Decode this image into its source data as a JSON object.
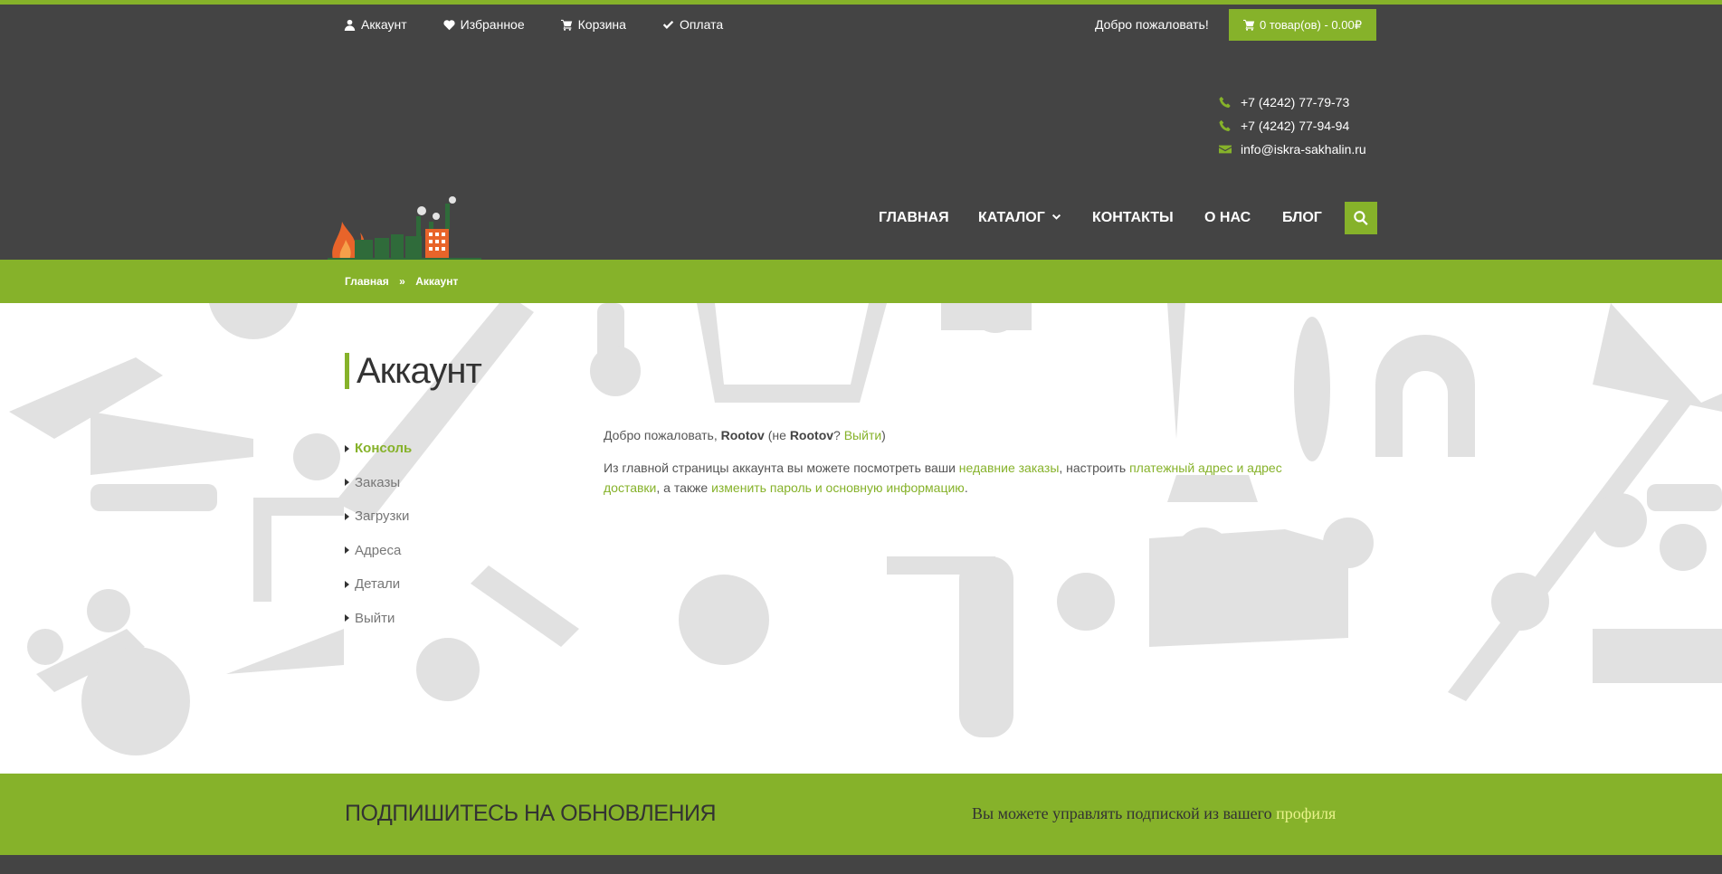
{
  "topbar": {
    "links": [
      {
        "label": "Аккаунт",
        "icon": "user-icon"
      },
      {
        "label": "Избранное",
        "icon": "heart-icon"
      },
      {
        "label": "Корзина",
        "icon": "cart-icon"
      },
      {
        "label": "Оплата",
        "icon": "check-icon"
      }
    ],
    "welcome": "Добро пожаловать!",
    "cart": "0 товар(ов) - 0.00₽"
  },
  "contacts": {
    "phone1": "+7 (4242) 77-79-73",
    "phone2": "+7 (4242) 77-94-94",
    "email": "info@iskra-sakhalin.ru"
  },
  "nav": {
    "home": "ГЛАВНАЯ",
    "catalog": "КАТАЛОГ",
    "contacts": "КОНТАКТЫ",
    "about": "О НАС",
    "blog": "БЛОГ"
  },
  "breadcrumb": {
    "home": "Главная",
    "sep": "»",
    "current": "Аккаунт"
  },
  "page": {
    "title": "Аккаунт",
    "menu": [
      "Консоль",
      "Заказы",
      "Загрузки",
      "Адреса",
      "Детали",
      "Выйти"
    ]
  },
  "account": {
    "p1_a": "Добро пожаловать, ",
    "user": "Rootov",
    "p1_b": " (не ",
    "user2": "Rootov",
    "p1_c": "? ",
    "logout": "Выйти",
    "p1_d": ")",
    "p2_a": "Из главной страницы аккаунта вы можете посмотреть ваши ",
    "recent_orders": "недавние заказы",
    "p2_b": ", настроить ",
    "addresses": "платежный адрес и адрес доставки",
    "p2_c": ", а также ",
    "edit": "изменить пароль и основную информацию",
    "p2_d": "."
  },
  "subscribe": {
    "title": "ПОДПИШИТЕСЬ НА ОБНОВЛЕНИЯ",
    "note": "Вы можете управлять подпиской из вашего ",
    "link": "профиля"
  },
  "colors": {
    "accent": "#86b22a",
    "dark": "#444444"
  }
}
